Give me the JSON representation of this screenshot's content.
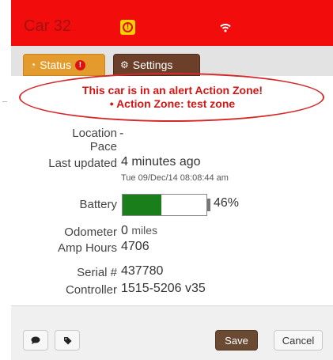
{
  "header": {
    "title": "Car 32",
    "alert_icon": "alert-icon",
    "status_icon": "wifi-icon"
  },
  "tabs": [
    {
      "label": "Status",
      "icon": "dashboard-icon",
      "badge": "!"
    },
    {
      "label": "Settings",
      "icon": "gears-icon"
    }
  ],
  "alert": {
    "line1": "This car is in an alert Action Zone!",
    "line2": "• Action Zone: test zone"
  },
  "details": {
    "location_label": "Location",
    "location_value": "-",
    "pace_label": "Pace",
    "last_updated_label": "Last updated",
    "last_updated_value": "4 minutes ago",
    "last_updated_timestamp": "Tue 09/Dec/14 08:08:44 am",
    "battery_label": "Battery",
    "battery_percent_text": "46%",
    "battery_level": 0.46,
    "odometer_label": "Odometer",
    "odometer_value": "0",
    "odometer_unit": "miles",
    "amp_hours_label": "Amp Hours",
    "amp_hours_value": "4706",
    "serial_label": "Serial #",
    "serial_value": "437780",
    "controller_label": "Controller",
    "controller_value": "1515-5206 v35"
  },
  "footer": {
    "comment_icon": "comment-icon",
    "tag_icon": "tag-icon",
    "save_label": "Save",
    "cancel_label": "Cancel"
  },
  "colors": {
    "header_bg": "#f20c0c",
    "status_tab": "#e49b2d",
    "settings_tab": "#6b3f2a",
    "alert_text": "#d31515",
    "battery_fill": "#1a7e1a",
    "save_button": "#6b4a33"
  }
}
